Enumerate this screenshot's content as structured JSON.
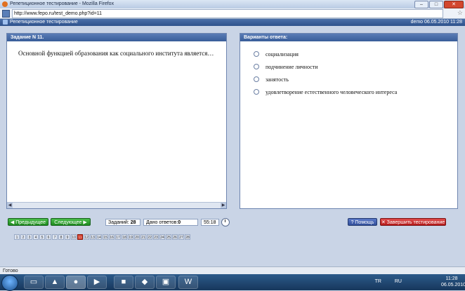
{
  "window": {
    "title": "Репетиционное тестирование - Mozilla Firefox",
    "min": "–",
    "max": "□",
    "close": "✕"
  },
  "browser": {
    "url": "http://www.fepo.ru/test_demo.php?id=11"
  },
  "app": {
    "title": "Репетиционное тестирование",
    "user_date": "demo 06.05.2010 11:28"
  },
  "question": {
    "header": "Задание N 11.",
    "text": "Основной функцией образования как социального института является…"
  },
  "answers": {
    "header": "Варианты ответа:",
    "options": [
      "социализация",
      "подчинение личности",
      "занятость",
      "удовлетворение естественного человеческого интереса"
    ]
  },
  "controls": {
    "prev": "◀ Предыдущее",
    "next": "Следующее ▶",
    "tasks_label": "Заданий:",
    "tasks_value": "28",
    "answered_label": "Дано ответов:",
    "answered_value": "0",
    "timer": "55:18",
    "help": "? Помощь",
    "finish": "✕ Завершить тестирование"
  },
  "pagination": {
    "current": 11,
    "items": [
      "1",
      "2",
      "3",
      "4",
      "5",
      "6",
      "7",
      "8",
      "9",
      "10",
      "11",
      "12",
      "13",
      "14",
      "15",
      "16",
      "17",
      "18",
      "19",
      "20",
      "21",
      "22",
      "23",
      "24",
      "25",
      "26",
      "27",
      "28"
    ]
  },
  "statusbar": {
    "text": "Готово"
  },
  "tray": {
    "lang1": "TR",
    "lang2": "RU",
    "time": "11:28",
    "date": "06.05.2010"
  }
}
